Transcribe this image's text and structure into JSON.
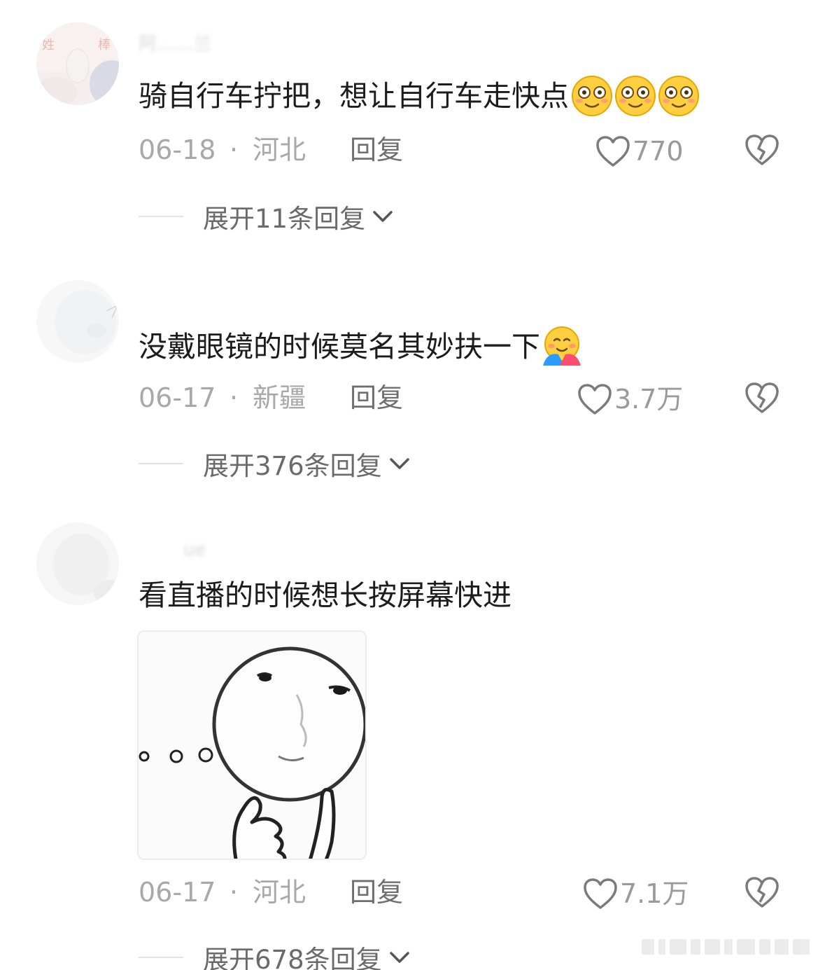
{
  "comments": [
    {
      "username": "阿……兰",
      "text": "骑自行车拧把，想让自行车走快点",
      "emoji": "grinning-face-emoji",
      "emoji_count": 3,
      "date": "06-18",
      "region": "河北",
      "reply_label": "回复",
      "likes": "770",
      "expand_label": "展开11条回复"
    },
    {
      "username": "",
      "text": "没戴眼镜的时候莫名其妙扶一下",
      "emoji": "hugging-face-emoji",
      "date": "06-17",
      "region": "新疆",
      "reply_label": "回复",
      "likes": "3.7万",
      "expand_label": "展开376条回复"
    },
    {
      "username": "ue",
      "text": "看直播的时候想长按屏幕快进",
      "has_sticker": true,
      "sticker": "thinking-meme-sticker",
      "date": "06-17",
      "region": "河北",
      "reply_label": "回复",
      "likes": "7.1万",
      "expand_label": "展开678条回复"
    }
  ],
  "separator": "·",
  "icons": {
    "like": "heart-outline-icon",
    "dislike": "broken-heart-icon",
    "expand": "chevron-down-icon"
  },
  "colors": {
    "text_primary": "#1c1c1c",
    "text_meta": "#a8a8a8",
    "text_reply": "#6f6f6f",
    "background": "#ffffff"
  }
}
